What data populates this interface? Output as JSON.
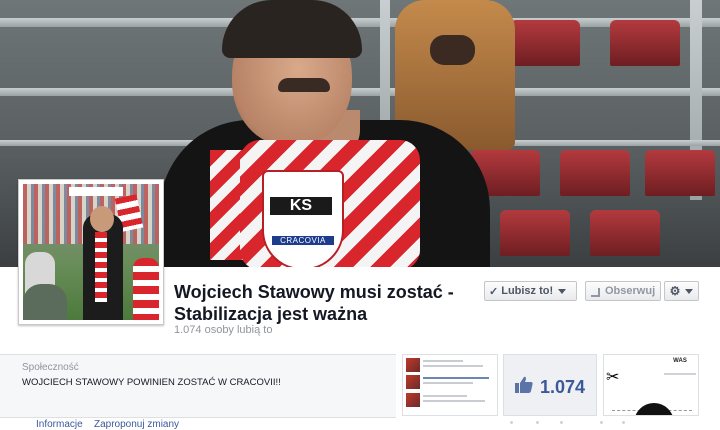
{
  "page": {
    "title": "Wojciech Stawowy musi zostać - Stabilizacja jest ważna",
    "likes_line": "1.074 osoby lubią to"
  },
  "cover": {
    "scarf_crest_text": "KS",
    "scarf_name_text": "CRACOVIA"
  },
  "actions": {
    "like_label": "Lubisz to!",
    "follow_label": "Obserwuj"
  },
  "about": {
    "category": "Społeczność",
    "description": "WOJCIECH STAWOWY POWINIEN ZOSTAĆ W CRACOVII!!"
  },
  "thumbnails": {
    "likes_count": "1.074",
    "app_title": "WAS"
  },
  "tabs": {
    "info": "Informacje",
    "suggest": "Zaproponuj zmiany"
  },
  "colors": {
    "link": "#3b5998",
    "title": "#141823",
    "muted": "#90949c"
  },
  "icons": [
    "like-thumb-icon",
    "check-icon",
    "rss-icon",
    "gear-icon",
    "chevron-down-icon",
    "scissors-icon"
  ]
}
